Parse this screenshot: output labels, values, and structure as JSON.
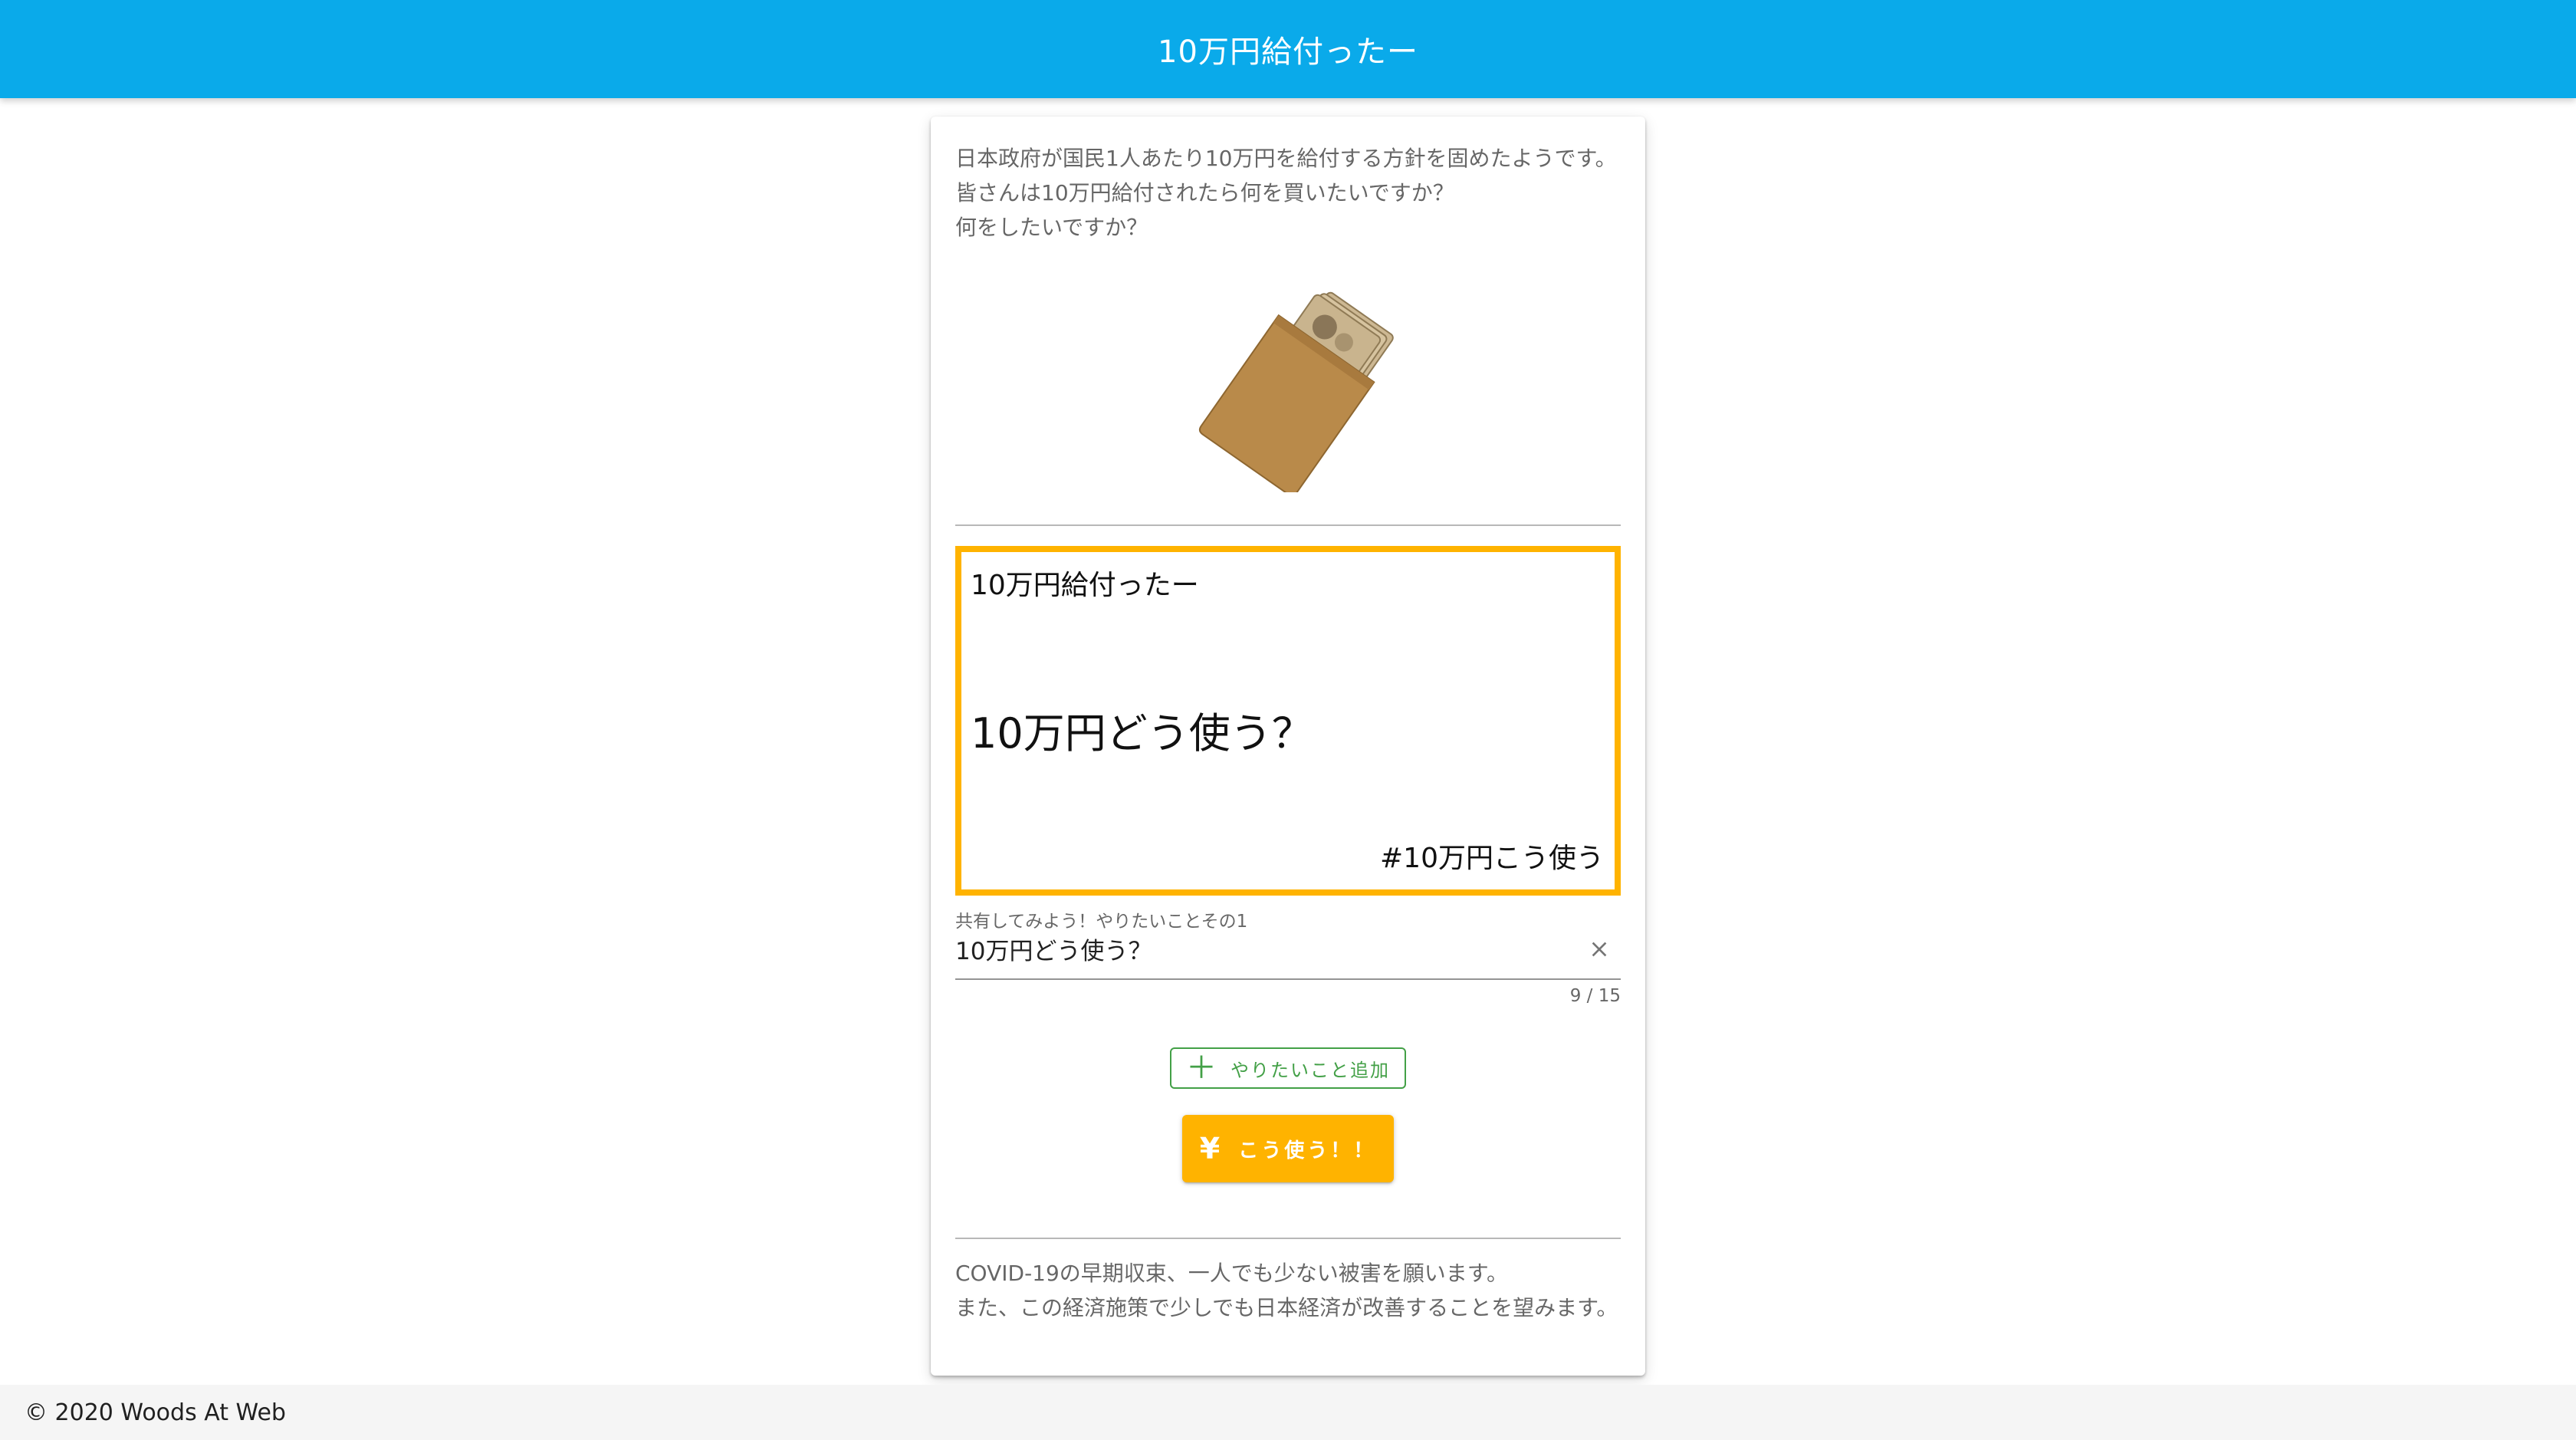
{
  "header": {
    "title": "10万円給付ったー"
  },
  "intro": {
    "lines": [
      "日本政府が国民1人あたり10万円を給付する方針を固めたようです。",
      "皆さんは10万円給付されたら何を買いたいですか？",
      "何をしたいですか？"
    ]
  },
  "illustration": {
    "icon": "money-envelope-icon",
    "envelope_color": "#b98a4a",
    "bills_color": "#c9b48e"
  },
  "preview": {
    "title": "10万円給付ったー",
    "main_text": "10万円どう使う？",
    "hashtag": "#10万円こう使う",
    "border_color": "#ffb300"
  },
  "field": {
    "label": "共有してみよう！やりたいことその1",
    "value": "10万円どう使う？",
    "counter": "9 / 15",
    "clear_icon": "close-icon"
  },
  "actions": {
    "add_label": "やりたいこと追加",
    "add_icon": "plus-icon",
    "add_color": "#43a047",
    "use_label": "こう使う！！",
    "use_icon": "yen-icon",
    "use_color": "#ffb300"
  },
  "outro": {
    "lines": [
      "COVID-19の早期収束、一人でも少ない被害を願います。",
      "また、この経済施策で少しでも日本経済が改善することを望みます。"
    ]
  },
  "footer": {
    "text": "© 2020 Woods At Web"
  },
  "theme": {
    "primary": "#0aaaea"
  }
}
